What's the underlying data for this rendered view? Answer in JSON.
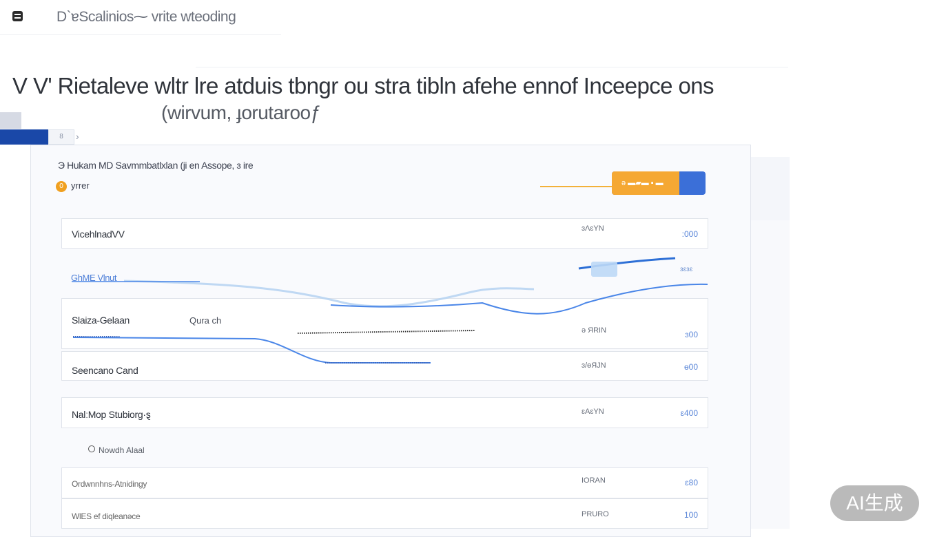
{
  "header": {
    "app_icon": "list-icon",
    "app_title": "D`ɐScalinios⁓ vrite wteoding"
  },
  "hero": {
    "title": "V V' Rietaleve wltr lre atduis tbngr ou stra tibln afehe ennof Inceepce ons",
    "subtitle": "(wirvum, ɟorutarooƒ"
  },
  "tabs": {
    "second_label": "8",
    "chevron_icon": "chevron-right-icon"
  },
  "panel": {
    "caption": "Э Hukam MD Savmmbatlxlan (ji en Assope, ɜ ire",
    "status_dot": "0",
    "status_text": "yrrer",
    "action_button_label": "ə ▬▰▬ ▪ ▬"
  },
  "rows": [
    {
      "name": "VicehlnadVV",
      "code": "ɜɅɛYN",
      "value": ":000"
    },
    {
      "name": "Slaiza-Gelaan",
      "code": "ə ЯRIN",
      "value": "ɜ00",
      "extra": "Qura ch"
    },
    {
      "name": "Seencano Cand",
      "code": "ɜ/ɵЯJN",
      "value": "ɵ00"
    },
    {
      "name": "NalːMop Stubiorg·ȿ",
      "code": "ɛAɛYN",
      "value": "ɛ400"
    },
    {
      "name": "Ordwnnhns-Atnidingy",
      "code": "IORAN",
      "value": "ɛ80"
    },
    {
      "name": "WlES ef diqleanəce",
      "code": "PRURO",
      "value": "100"
    }
  ],
  "series_label": "GhME Vlnut",
  "series_value": "ɜɛɜɛ",
  "radio_label": "Nowdh Alaal",
  "watermark": "AI生成",
  "colors": {
    "accent_blue": "#1a48a8",
    "line_blue": "#4a86e8",
    "button_orange": "#f5a833",
    "button_blue": "#3b6fd8"
  }
}
